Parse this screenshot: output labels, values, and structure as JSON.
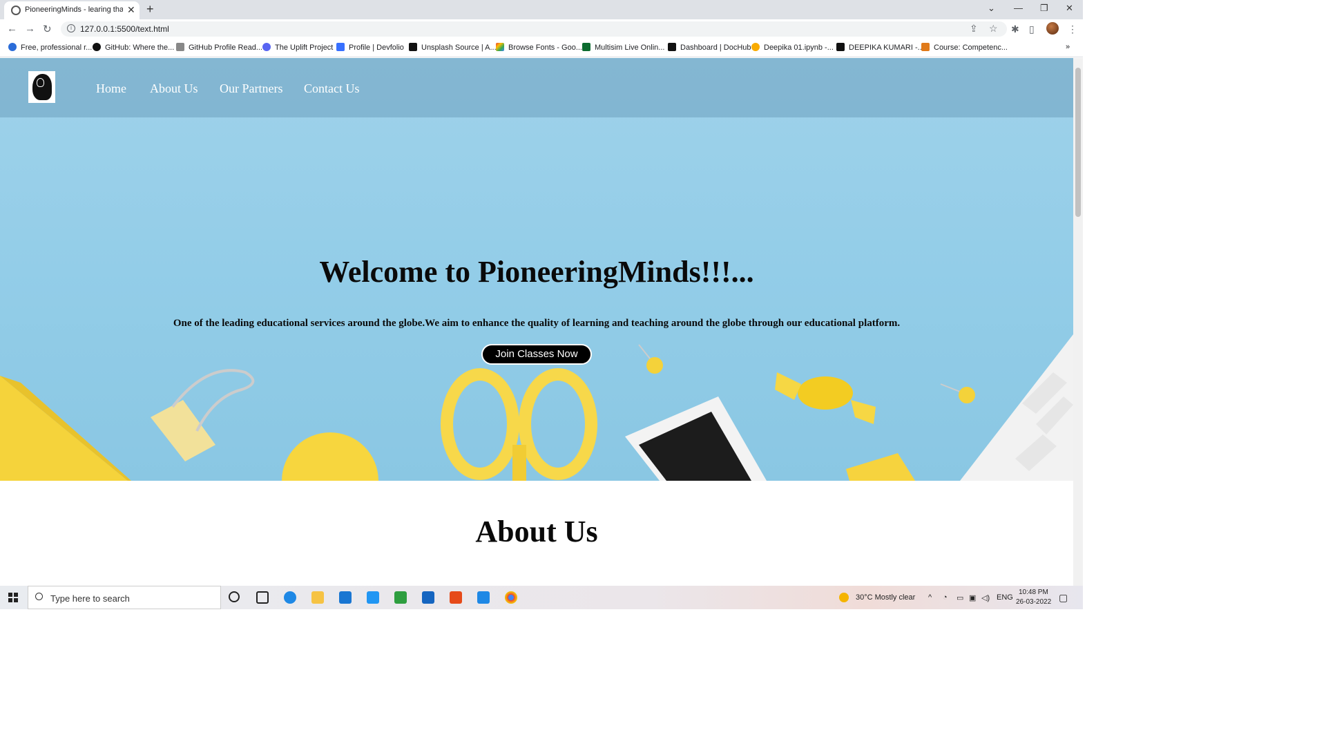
{
  "browser": {
    "tab_title": "PioneeringMinds - learing that in",
    "url": "127.0.0.1:5500/text.html",
    "bookmarks": [
      "Free, professional r...",
      "GitHub: Where the...",
      "GitHub Profile Read...",
      "The Uplift Project",
      "Profile | Devfolio",
      "Unsplash Source | A...",
      "Browse Fonts - Goo...",
      "Multisim Live Onlin...",
      "Dashboard | DocHub",
      "Deepika 01.ipynb -...",
      "DEEPIKA KUMARI -...",
      "Course: Competenc..."
    ]
  },
  "site": {
    "nav": [
      "Home",
      "About Us",
      "Our Partners",
      "Contact Us"
    ],
    "hero_title": "Welcome to PioneeringMinds!!!...",
    "hero_subtitle": "One of the leading educational services around the globe.We aim to enhance the quality of learning and teaching around the globe through our educational platform.",
    "cta_label": "Join Classes Now",
    "about_title": "About Us"
  },
  "taskbar": {
    "search_placeholder": "Type here to search",
    "weather": "30°C  Mostly clear",
    "language": "ENG",
    "time": "10:48 PM",
    "date": "26-03-2022"
  },
  "colors": {
    "hero_bg": "#9fd2ea",
    "cta_bg": "#000000",
    "accent_yellow": "#f5d33b"
  }
}
